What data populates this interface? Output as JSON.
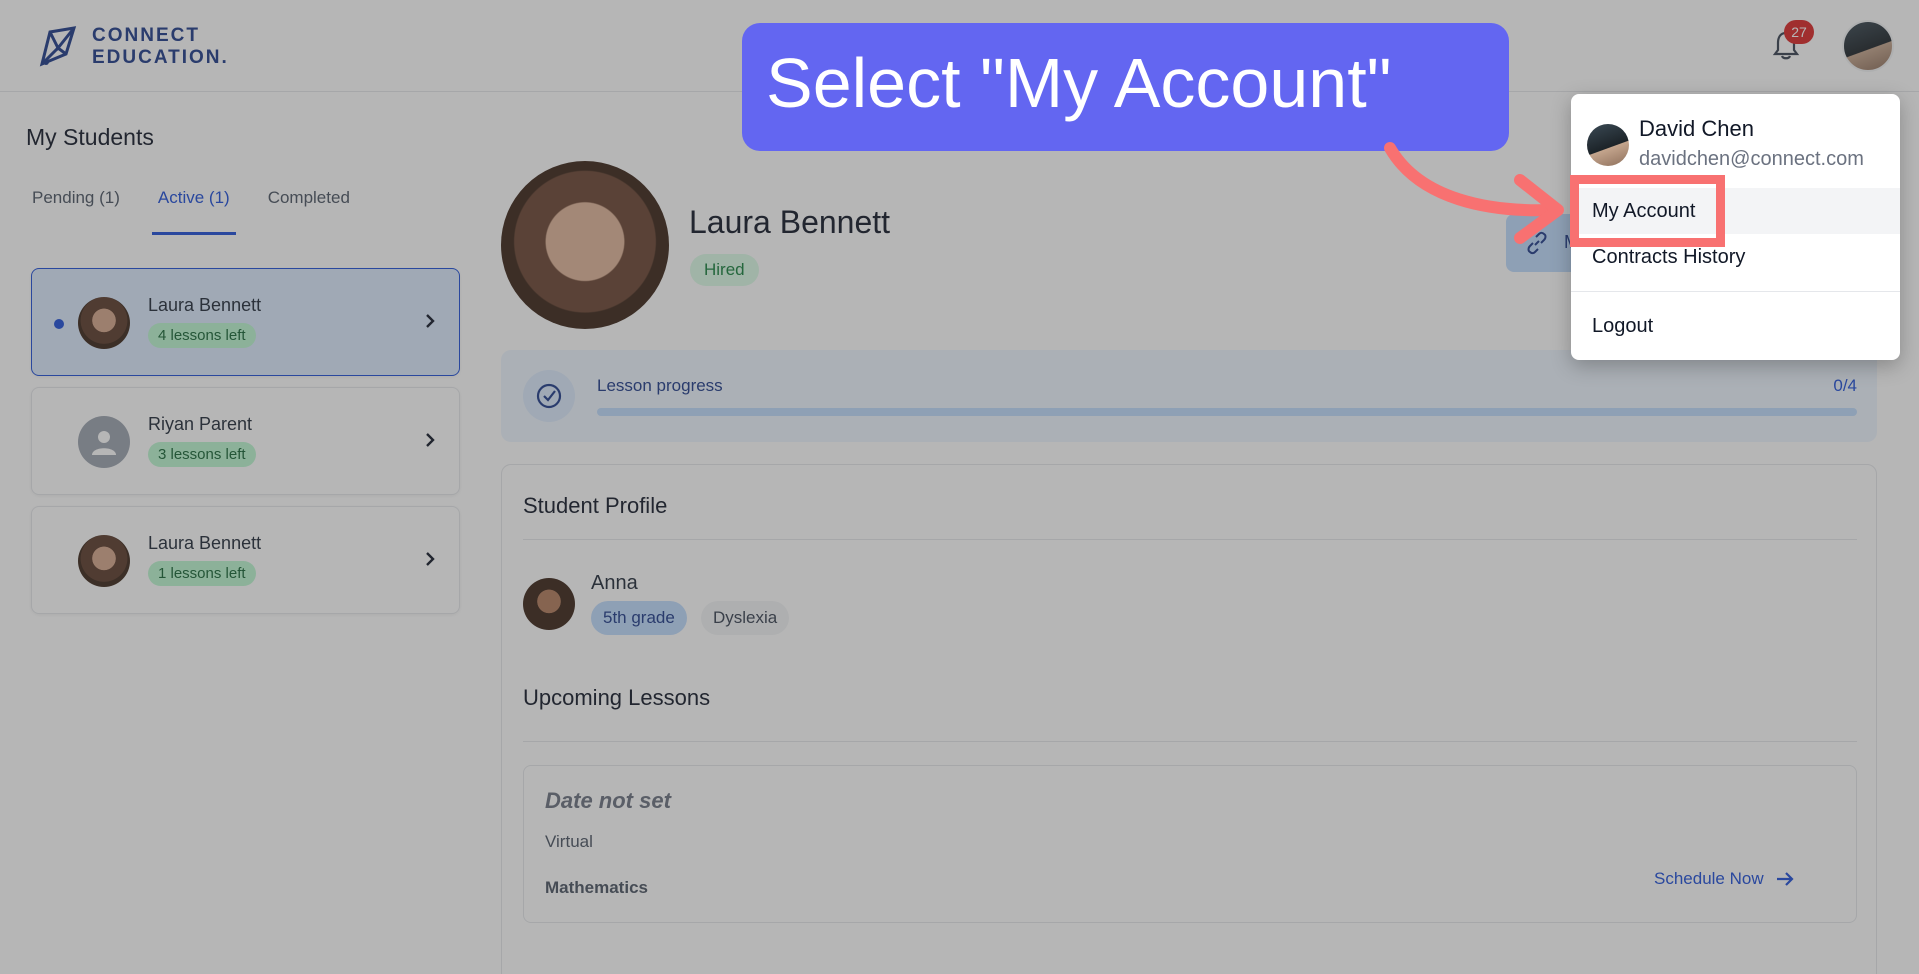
{
  "header": {
    "logo_line1": "CONNECT",
    "logo_line2": "EDUCATION.",
    "notification_count": "27"
  },
  "sidebar": {
    "title": "My Students",
    "tabs": [
      {
        "label": "Pending (1)",
        "active": false
      },
      {
        "label": "Active (1)",
        "active": true
      },
      {
        "label": "Completed",
        "active": false
      }
    ],
    "students": [
      {
        "name": "Laura Bennett",
        "lessons": "4 lessons left",
        "selected": true
      },
      {
        "name": "Riyan Parent",
        "lessons": "3 lessons left",
        "selected": false
      },
      {
        "name": "Laura Bennett",
        "lessons": "1 lessons left",
        "selected": false
      }
    ]
  },
  "main": {
    "student_name": "Laura Bennett",
    "status": "Hired",
    "message_button_label": "M",
    "progress": {
      "label": "Lesson progress",
      "count": "0/4",
      "fraction": 0
    },
    "profile": {
      "title": "Student Profile",
      "child_name": "Anna",
      "grade": "5th grade",
      "condition": "Dyslexia"
    },
    "upcoming": {
      "title": "Upcoming Lessons",
      "lesson": {
        "date": "Date not set",
        "mode": "Virtual",
        "subject": "Mathematics",
        "action": "Schedule Now"
      }
    }
  },
  "dropdown": {
    "user_name": "David Chen",
    "user_email": "davidchen@connect.com",
    "items": [
      "My Account",
      "Contracts History",
      "Logout"
    ]
  },
  "tutorial": {
    "instruction": "Select \"My Account\""
  },
  "colors": {
    "accent": "#1d4ed8",
    "callout": "#6366f1",
    "highlight": "#f87171",
    "success": "#15803d",
    "badge": "#dc2626"
  }
}
